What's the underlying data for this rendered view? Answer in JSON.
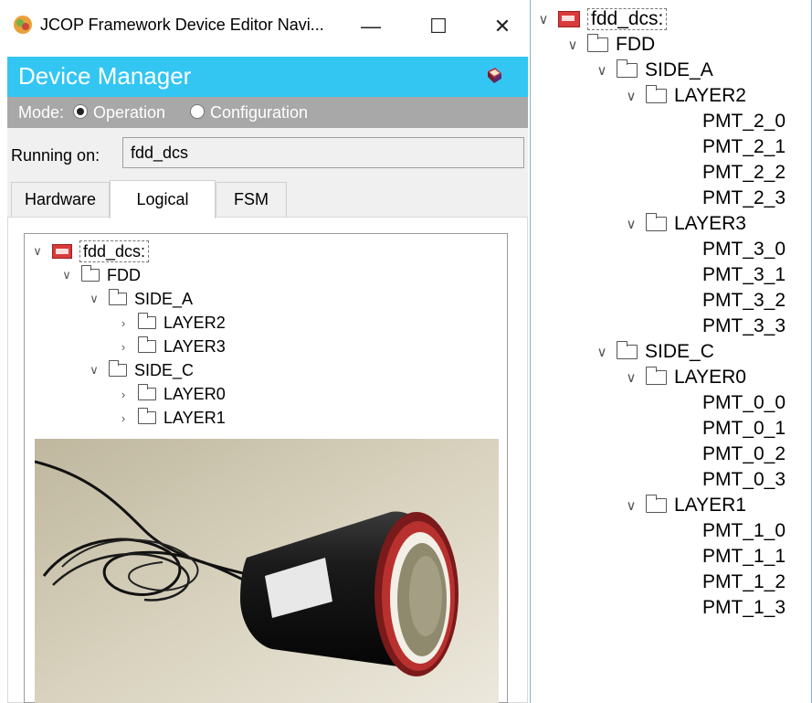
{
  "window": {
    "title": "JCOP Framework Device Editor Navi...",
    "minimize": "—",
    "maximize": "☐",
    "close": "✕"
  },
  "header": {
    "title": "Device Manager",
    "mode_label": "Mode:",
    "mode_options": [
      {
        "label": "Operation",
        "selected": true
      },
      {
        "label": "Configuration",
        "selected": false
      }
    ]
  },
  "running_on": {
    "label": "Running on:",
    "value": "fdd_dcs"
  },
  "tabs": [
    {
      "label": "Hardware",
      "active": false
    },
    {
      "label": "Logical",
      "active": true
    },
    {
      "label": "FSM",
      "active": false
    }
  ],
  "logical_tree": {
    "root": "fdd_dcs:",
    "fdd": "FDD",
    "side_a": "SIDE_A",
    "side_a_layers": [
      "LAYER2",
      "LAYER3"
    ],
    "side_c": "SIDE_C",
    "side_c_layers": [
      "LAYER0",
      "LAYER1"
    ]
  },
  "expanded_tree": {
    "root": "fdd_dcs:",
    "fdd": "FDD",
    "side_a": "SIDE_A",
    "layer2": "LAYER2",
    "layer2_pmts": [
      "PMT_2_0",
      "PMT_2_1",
      "PMT_2_2",
      "PMT_2_3"
    ],
    "layer3": "LAYER3",
    "layer3_pmts": [
      "PMT_3_0",
      "PMT_3_1",
      "PMT_3_2",
      "PMT_3_3"
    ],
    "side_c": "SIDE_C",
    "layer0": "LAYER0",
    "layer0_pmts": [
      "PMT_0_0",
      "PMT_0_1",
      "PMT_0_2",
      "PMT_0_3"
    ],
    "layer1": "LAYER1",
    "layer1_pmts": [
      "PMT_1_0",
      "PMT_1_1",
      "PMT_1_2",
      "PMT_1_3"
    ]
  },
  "colors": {
    "header_blue": "#33c6f3",
    "mode_bar_gray": "#a8a8a8",
    "system_icon_red": "#d93a3a",
    "panel_border_blue": "#7fb1e4"
  }
}
